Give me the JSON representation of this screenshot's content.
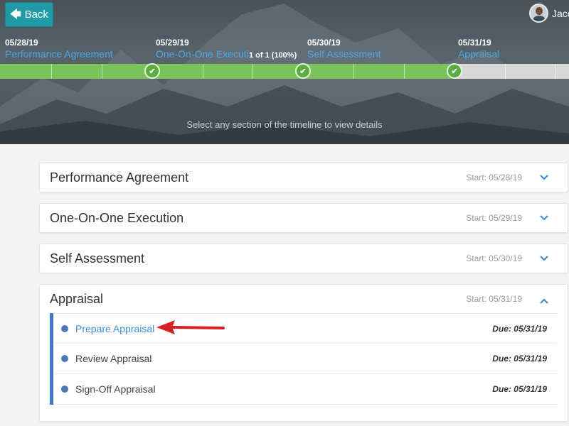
{
  "header": {
    "back_label": "Back",
    "user_name": "Jaco",
    "progress_text": "1 of 1 (100%)",
    "hint": "Select any section of the timeline to view details",
    "milestones": [
      {
        "date": "05/28/19",
        "label": "Performance Agreement"
      },
      {
        "date": "05/29/19",
        "label": "One-On-One Execution"
      },
      {
        "date": "05/30/19",
        "label": "Self Assessment"
      },
      {
        "date": "05/31/19",
        "label": "Appraisal"
      }
    ],
    "timeline_progress_fraction": 0.8
  },
  "sections": [
    {
      "title": "Performance Agreement",
      "start": "Start: 05/28/19",
      "expanded": false
    },
    {
      "title": "One-On-One Execution",
      "start": "Start: 05/29/19",
      "expanded": false
    },
    {
      "title": "Self Assessment",
      "start": "Start: 05/30/19",
      "expanded": false
    },
    {
      "title": "Appraisal",
      "start": "Start: 05/31/19",
      "expanded": true,
      "tasks": [
        {
          "name": "Prepare Appraisal",
          "due": "Due: 05/31/19"
        },
        {
          "name": "Review Appraisal",
          "due": "Due: 05/31/19"
        },
        {
          "name": "Sign-Off Appraisal",
          "due": "Due: 05/31/19"
        }
      ]
    }
  ],
  "colors": {
    "accent": "#1f9aa6",
    "timeline_green": "#79c35a",
    "link_blue": "#3c8fd6",
    "task_bar": "#3e78c4",
    "annotation_red": "#d92020"
  }
}
